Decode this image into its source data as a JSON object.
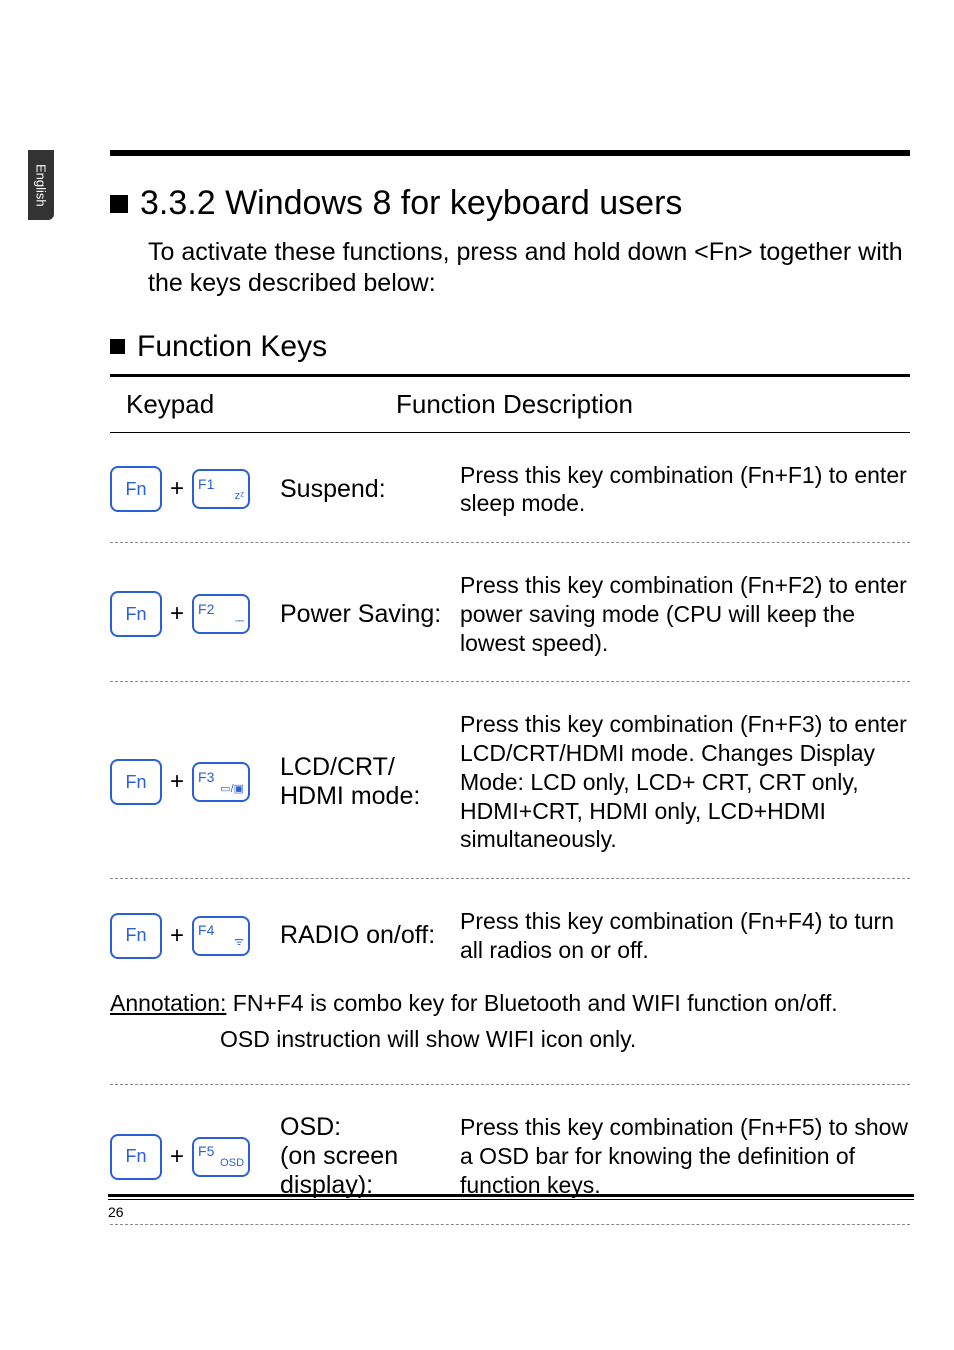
{
  "sideTab": "English",
  "sectionNumber": "3.3.2",
  "sectionTitle": "Windows 8 for keyboard users",
  "intro": "To activate these functions, press and hold down <Fn> together with the keys described below:",
  "subTitle": "Function Keys",
  "tableHead": {
    "col1": "Keypad",
    "col2": "Function Description"
  },
  "rows": [
    {
      "fn": "Fn",
      "plus": "+",
      "fkeyTop": "F1",
      "fkeyBot": "zᶻ",
      "name": "Suspend:",
      "desc": "Press this key combination (Fn+F1) to enter sleep mode."
    },
    {
      "fn": "Fn",
      "plus": "+",
      "fkeyTop": "F2",
      "fkeyBot": "⎓",
      "name": "Power Saving:",
      "desc": "Press this key combination (Fn+F2) to enter power saving mode (CPU will keep the lowest speed)."
    },
    {
      "fn": "Fn",
      "plus": "+",
      "fkeyTop": "F3",
      "fkeyBot": "▭/▣",
      "name": "LCD/CRT/ HDMI mode:",
      "desc": "Press this key combination (Fn+F3) to enter LCD/CRT/HDMI mode. Changes Display Mode: LCD only, LCD+ CRT, CRT only, HDMI+CRT, HDMI only, LCD+HDMI simultaneously."
    },
    {
      "fn": "Fn",
      "plus": "+",
      "fkeyTop": "F4",
      "fkeyBot": "ᯤ",
      "name": "RADIO on/off:",
      "desc": "Press this key combination (Fn+F4) to turn all radios on or off."
    },
    {
      "fn": "Fn",
      "plus": "+",
      "fkeyTop": "F5",
      "fkeyBot": "OSD",
      "name": "OSD:\n(on screen display):",
      "desc": "Press this key combination (Fn+F5) to show a OSD bar for knowing the definition of function keys."
    }
  ],
  "annotation": {
    "label": "Annotation:",
    "line1": "FN+F4 is combo key for Bluetooth and WIFI function on/off.",
    "line2": "OSD instruction will show WIFI icon only."
  },
  "pageNumber": "26"
}
